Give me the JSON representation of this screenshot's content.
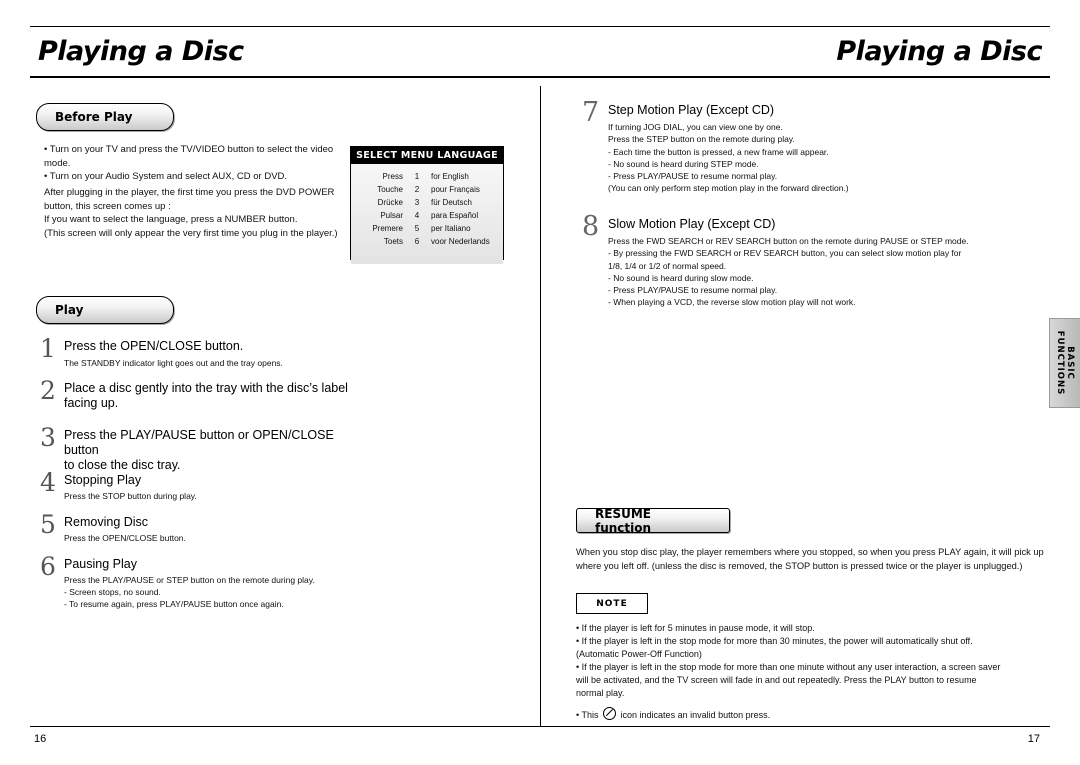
{
  "header": {
    "title_left": "Playing a Disc",
    "title_right": "Playing a Disc"
  },
  "left_page": {
    "page_number": "16",
    "sections": {
      "before_play": {
        "label": "Before Play",
        "bullets": "• Turn on your TV and press the TV/VIDEO button to select the video mode.\n• Turn on your Audio System and select AUX, CD or DVD.",
        "paragraph": "After plugging in the player, the first time you press the DVD POWER\nbutton, this screen comes up :\nIf you want to select the language, press a NUMBER button.\n(This screen will only appear the very first time you plug in the player.)"
      },
      "play": {
        "label": "Play",
        "steps": [
          {
            "num": "1",
            "headline": "Press the OPEN/CLOSE button.",
            "sub": "The STANDBY indicator light goes out and the tray opens."
          },
          {
            "num": "2",
            "headline": "Place a disc gently into the tray with the disc’s label\nfacing up.",
            "sub": ""
          },
          {
            "num": "3",
            "headline": "Press the PLAY/PAUSE button or OPEN/CLOSE button\nto close the disc tray.",
            "sub": ""
          },
          {
            "num": "4",
            "headline": "Stopping Play",
            "sub": "Press the STOP button during play."
          },
          {
            "num": "5",
            "headline": "Removing Disc",
            "sub": "Press the OPEN/CLOSE button."
          },
          {
            "num": "6",
            "headline": "Pausing Play",
            "sub": "Press the PLAY/PAUSE or STEP button on the remote during play.\n- Screen stops, no sound.\n- To resume again, press PLAY/PAUSE button once again."
          }
        ]
      }
    },
    "menu_box": {
      "title": "SELECT MENU LANGUAGE",
      "rows": [
        {
          "word": "Press",
          "number": "1",
          "language": "for English"
        },
        {
          "word": "Touche",
          "number": "2",
          "language": "pour Français"
        },
        {
          "word": "Drücke",
          "number": "3",
          "language": "für Deutsch"
        },
        {
          "word": "Pulsar",
          "number": "4",
          "language": "para Español"
        },
        {
          "word": "Premere",
          "number": "5",
          "language": "per Italiano"
        },
        {
          "word": "Toets",
          "number": "6",
          "language": "voor Nederlands"
        }
      ]
    }
  },
  "right_page": {
    "page_number": "17",
    "steps": [
      {
        "num": "7",
        "headline": "Step Motion Play (Except CD)",
        "sub": "If turning JOG DIAL, you can view one by one.\nPress the STEP button on the remote during play.\n- Each time the button is pressed, a new frame will appear.\n- No sound is heard during STEP mode.\n- Press PLAY/PAUSE to resume normal play.\n(You can only perform step motion play in the forward direction.)"
      },
      {
        "num": "8",
        "headline": "Slow Motion Play (Except CD)",
        "sub": "Press the FWD SEARCH or REV SEARCH button on the remote during PAUSE or STEP mode.\n- By pressing the FWD SEARCH or REV SEARCH button, you can select slow motion play for\n  1/8, 1/4 or 1/2 of normal speed.\n- No sound is heard during slow mode.\n- Press PLAY/PAUSE to resume normal play.\n- When playing a VCD, the reverse slow motion play will not work."
      }
    ],
    "resume": {
      "label": "RESUME function",
      "paragraph": "When you stop disc play, the player remembers where you stopped, so when you press PLAY again, it will pick up\nwhere you left off. (unless the disc is removed, the STOP button is pressed twice or the player is unplugged.)"
    },
    "note": {
      "label": "NOTE",
      "items_before_icon": "• If the player is left for 5 minutes in pause mode, it will stop.\n• If the player is left in the stop mode for more than 30 minutes, the power will automatically shut off.\n  (Automatic Power-Off Function)\n• If the player is left in the stop mode for more than one minute without any user interaction, a screen saver\n  will be activated, and the TV screen will fade in and out repeatedly. Press the PLAY button to resume\n  normal play.",
      "last_item_prefix": "• This",
      "last_item_suffix": "icon indicates an invalid button press."
    },
    "side_tab": "BASIC FUNCTIONS"
  }
}
